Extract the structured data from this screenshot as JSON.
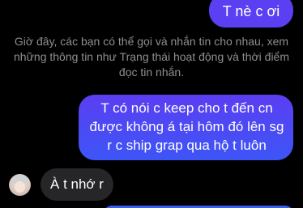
{
  "messages": {
    "outgoing_top": "T nè c ơi",
    "system_notice": "Giờ đây, các bạn có thể gọi và nhắn tin cho nhau, xem những thông tin như Trạng thái hoạt động và thời điểm đọc tin nhắn.",
    "outgoing_main": "T có nói c keep cho t đến cn được không á tại hôm đó lên sg r c ship grap qua hộ t luôn",
    "incoming": "À t nhớ r"
  },
  "colors": {
    "background": "#000000",
    "outgoing_bubble": "#5a3ff3",
    "incoming_bubble": "#262629",
    "system_text": "#8e8e93"
  }
}
